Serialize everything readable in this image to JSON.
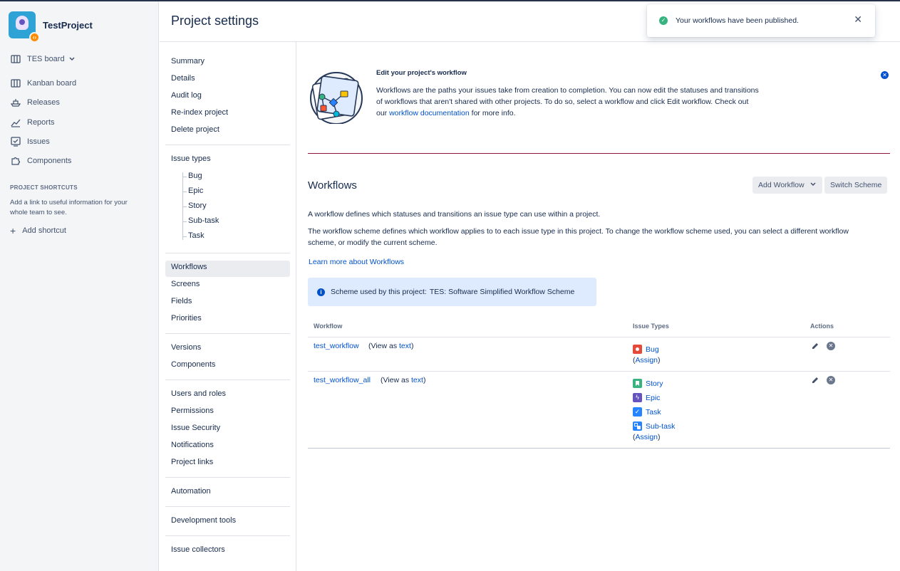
{
  "sidebar": {
    "project_name": "TestProject",
    "board_selector": "TES board",
    "nav": [
      {
        "label": "Kanban board",
        "icon": "board-icon"
      },
      {
        "label": "Releases",
        "icon": "ship-icon"
      },
      {
        "label": "Reports",
        "icon": "chart-icon"
      },
      {
        "label": "Issues",
        "icon": "issues-icon"
      },
      {
        "label": "Components",
        "icon": "puzzle-icon"
      }
    ],
    "shortcuts_title": "PROJECT SHORTCUTS",
    "shortcuts_desc": "Add a link to useful information for your whole team to see.",
    "add_shortcut": "Add shortcut"
  },
  "header": {
    "title": "Project settings"
  },
  "settings_nav": {
    "group1": [
      "Summary",
      "Details",
      "Audit log",
      "Re-index project",
      "Delete project"
    ],
    "issue_types_label": "Issue types",
    "issue_types": [
      "Bug",
      "Epic",
      "Story",
      "Sub-task",
      "Task"
    ],
    "group3": [
      "Workflows",
      "Screens",
      "Fields",
      "Priorities"
    ],
    "group4": [
      "Versions",
      "Components"
    ],
    "group5": [
      "Users and roles",
      "Permissions",
      "Issue Security",
      "Notifications",
      "Project links"
    ],
    "group6": [
      "Automation"
    ],
    "group7": [
      "Development tools"
    ],
    "group8": [
      "Issue collectors"
    ]
  },
  "info_panel": {
    "title": "Edit your project's workflow",
    "body_before": "Workflows are the paths your issues take from creation to completion. You can now edit the statuses and transitions of workflows that aren't shared with other projects. To do so, select a workflow and click Edit workflow. Check out our ",
    "link": "workflow documentation",
    "body_after": " for more info."
  },
  "workflows": {
    "heading": "Workflows",
    "add_button": "Add Workflow",
    "switch_button": "Switch Scheme",
    "para1": "A workflow defines which statuses and transitions an issue type can use within a project.",
    "para2": "The workflow scheme defines which workflow applies to to each issue type in this project. To change the workflow scheme used, you can select a different workflow scheme, or modify the current scheme.",
    "learn_more": "Learn more about Workflows",
    "scheme_label": "Scheme used by this project:",
    "scheme_name": "TES: Software Simplified Workflow Scheme"
  },
  "table": {
    "headers": [
      "Workflow",
      "Issue Types",
      "Actions"
    ],
    "view_as": "(View as",
    "view_link": "text",
    "assign_open": "(",
    "assign_link": "Assign",
    "assign_close": ")",
    "rows": [
      {
        "name": "test_workflow",
        "types": [
          {
            "label": "Bug",
            "color": "#e5493a",
            "icon": "bug-icon"
          }
        ]
      },
      {
        "name": "test_workflow_all",
        "types": [
          {
            "label": "Story",
            "color": "#36b37e",
            "icon": "story-icon"
          },
          {
            "label": "Epic",
            "color": "#6554c0",
            "icon": "epic-icon"
          },
          {
            "label": "Task",
            "color": "#2684ff",
            "icon": "task-icon"
          },
          {
            "label": "Sub-task",
            "color": "#2684ff",
            "icon": "subtask-icon"
          }
        ]
      }
    ]
  },
  "toast": {
    "message": "Your workflows have been published."
  }
}
